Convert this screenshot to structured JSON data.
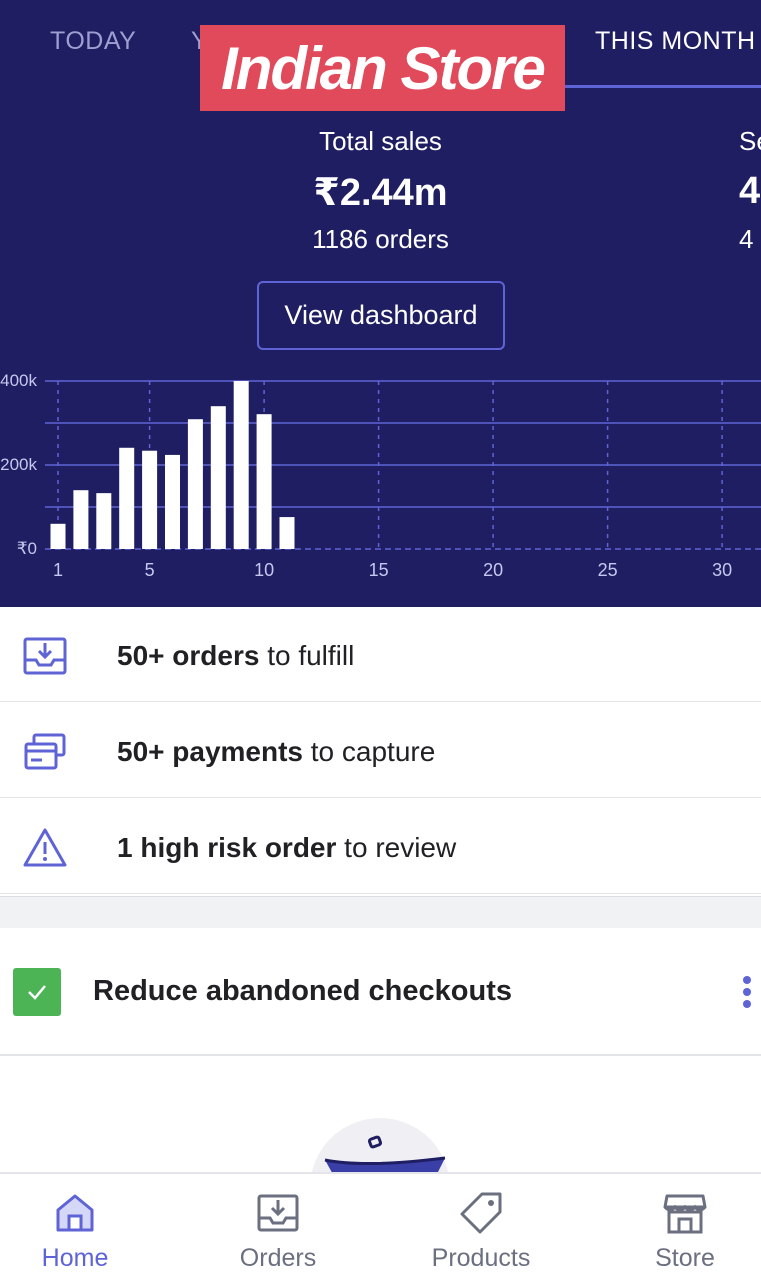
{
  "header": {
    "tabs": [
      "TODAY",
      "Y",
      "THIS MONTH"
    ],
    "active_tab": "THIS MONTH",
    "brand_banner": "Indian Store",
    "primary_stat": {
      "label": "Total sales",
      "value": "₹2.44m",
      "sub": "1186 orders"
    },
    "secondary_stat": {
      "label": "Se",
      "value": "4",
      "sub": "4"
    },
    "dashboard_button": "View dashboard"
  },
  "chart_data": {
    "type": "bar",
    "x": [
      1,
      2,
      3,
      4,
      5,
      6,
      7,
      8,
      9,
      10,
      11,
      12,
      13,
      14,
      15,
      16,
      17,
      18,
      19,
      20,
      21,
      22,
      23,
      24,
      25,
      26,
      27,
      28,
      29,
      30,
      31
    ],
    "values": [
      60000,
      140000,
      133000,
      241000,
      234000,
      224000,
      309000,
      340000,
      400000,
      321000,
      76000,
      0,
      0,
      0,
      0,
      0,
      0,
      0,
      0,
      0,
      0,
      0,
      0,
      0,
      0,
      0,
      0,
      0,
      0,
      0,
      0
    ],
    "x_ticks": [
      "1",
      "5",
      "10",
      "15",
      "20",
      "25",
      "30"
    ],
    "y_ticks": [
      "₹0",
      "200k",
      "400k"
    ],
    "ylim": [
      0,
      400000
    ],
    "grid": true,
    "colors": {
      "bar": "#ffffff",
      "grid": "#5e63d6",
      "axis_text": "#c5c7ee",
      "background": "#1f1e62"
    }
  },
  "tasks": [
    {
      "icon": "inbox-download-icon",
      "bold": "50+ orders",
      "rest": " to fulfill"
    },
    {
      "icon": "payment-cards-icon",
      "bold": "50+ payments",
      "rest": " to capture"
    },
    {
      "icon": "warning-triangle-icon",
      "bold": "1 high risk order",
      "rest": " to review"
    }
  ],
  "card": {
    "title": "Reduce abandoned checkouts",
    "status_icon": "checkmark-icon",
    "menu_icon": "more-vertical-icon"
  },
  "nav": {
    "items": [
      {
        "label": "Home",
        "icon": "home-icon",
        "active": true
      },
      {
        "label": "Orders",
        "icon": "orders-icon",
        "active": false
      },
      {
        "label": "Products",
        "icon": "tag-icon",
        "active": false
      },
      {
        "label": "Store",
        "icon": "store-icon",
        "active": false
      }
    ]
  },
  "colors": {
    "header_bg": "#1f1e62",
    "accent": "#5e63d6",
    "brand_banner": "#e04a5a",
    "success": "#4cb454",
    "text_dark": "#202124"
  }
}
